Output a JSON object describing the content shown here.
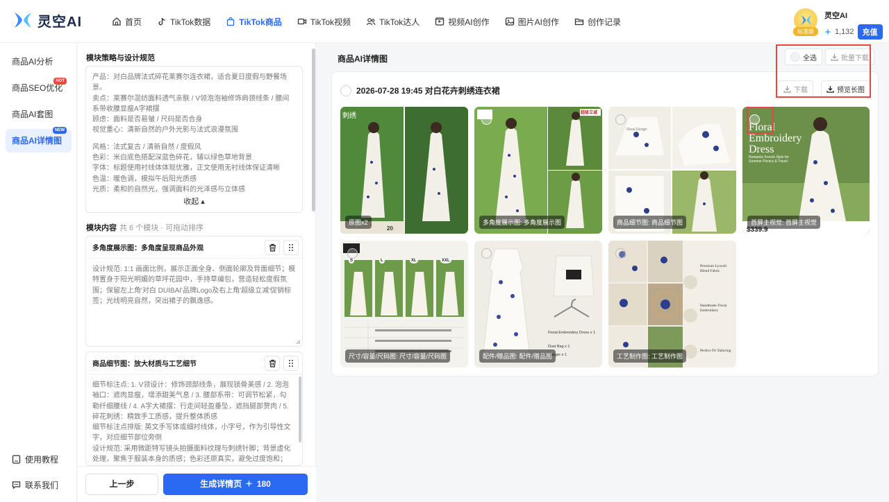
{
  "app": {
    "name": "灵空AI"
  },
  "nav": [
    {
      "label": "首页",
      "icon": "home-icon"
    },
    {
      "label": "TikTok数据",
      "icon": "tiktok-icon"
    },
    {
      "label": "TikTok商品",
      "icon": "shopping-bag-icon"
    },
    {
      "label": "TikTok视频",
      "icon": "video-icon"
    },
    {
      "label": "TikTok达人",
      "icon": "users-icon"
    },
    {
      "label": "视频AI创作",
      "icon": "video-ai-icon"
    },
    {
      "label": "图片AI创作",
      "icon": "image-icon"
    },
    {
      "label": "创作记录",
      "icon": "folder-icon"
    }
  ],
  "user": {
    "name": "灵空AI",
    "badge": "标准版",
    "credits": "1,132",
    "topup": "充值"
  },
  "sidebar": {
    "items": [
      {
        "label": "商品AI分析"
      },
      {
        "label": "商品SEO优化",
        "tag": "HOT"
      },
      {
        "label": "商品AI套图"
      },
      {
        "label": "商品AI详情图",
        "tag": "NEW"
      }
    ],
    "tutorial": "使用教程",
    "contact": "联系我们"
  },
  "strategy": {
    "title": "模块策略与设计规范",
    "lines1": [
      "产品：对白品牌法式碎花莱赛尔连衣裙，适合夏日度假与野餐场景。",
      "卖点：莱赛尔混纺面料透气亲肤 / V领泡泡袖修饰肩颈线条 / 腰间系带收腰显瘦A字裙摆",
      "顾虑：面料是否易皱 / 尺码是否合身",
      "视觉重心：清新自然的户外光影与法式浪漫氛围"
    ],
    "lines2": [
      "风格：法式复古 / 清新自然 / 度假风",
      "色彩：米白底色搭配深蓝色碎花，辅以绿色草地背景",
      "字体：标题使用衬线体体现优雅，正文使用无衬线体保证清晰",
      "色温：暖色调，模拟午后阳光质感",
      "光质：柔和的自然光，强调面料的光泽感与立体感"
    ],
    "collapse": "收起"
  },
  "modules": {
    "title": "模块内容",
    "subtitle": "共 6 个模块 · 可拖动排序",
    "items": [
      {
        "title": "多角度展示图：多角度呈现商品外观",
        "body": "设计规范: 1:1 画面比例，展示正面全身、侧面轮廓及背面细节；模特置身于阳光明媚的草坪花园中，手持草编包，营造轻松度假氛围；保留左上角'对白 DUIBAI'品牌Logo及右上角'超级立减'促销标签；光线明亮自然，突出裙子的飘逸感。"
      },
      {
        "title": "商品细节图：放大材质与工艺细节",
        "body": "细节标注点: 1. V领设计：修饰颈部线条，展现锁骨美感 / 2. 泡泡袖口：遮肉显瘦，增添甜美气息 / 3. 腰部系带：可调节松紧，勾勒纤细腰线 / 4. A字大裙摆：行走间轻盈垂坠，遮挡腿部赘肉 / 5. 碎花刺绣：精致手工质感，提升整体质感\n细节标注点排版: 英文手写体或细衬线体，小字号，作为引导性文字，对应细节部位旁侧\n设计规范: 采用微距特写镜头拍摄面料纹理与刺绣针脚；背景虚化处理，聚焦于服装本身的质感；色彩还原真实，避免过度饱和；保留参考"
      }
    ]
  },
  "actions": {
    "prev": "上一步",
    "generate": "生成详情页",
    "cost": "180"
  },
  "main": {
    "title": "商品AI详情图",
    "select_all": "全选",
    "batch_download": "批量下载",
    "card": {
      "title": "2026-07-28 19:45 对白花卉刺绣连衣裙",
      "download": "下载",
      "preview": "预览长图",
      "images": [
        {
          "label": "原图x2",
          "overlay": "刺绣",
          "price": "20"
        },
        {
          "label": "多角度展示图: 多角度展示图",
          "overlay": "超级立减"
        },
        {
          "label": "商品细节图: 商品细节图",
          "overlay": "Floral Design"
        },
        {
          "label": "首屏主视觉: 首屏主视觉",
          "overlay": "Floral Embroidery Dress",
          "sub": "Romantic French Style for Summer Picnics & Travel",
          "price": "$339.9"
        },
        {
          "label": "尺寸/容量/尺码图: 尺寸/容量/尺码图",
          "sizes": [
            "S",
            "L",
            "XL",
            "XXL"
          ]
        },
        {
          "label": "配件/赠品图: 配件/赠品图",
          "items": [
            "Floral Embroidery Dress x 1",
            "Dust Bag x 1",
            "Hanger x 1"
          ]
        },
        {
          "label": "工艺制作图: 工艺制作图",
          "notes": [
            "Premium Lyocell Blend Fabric",
            "Handmade Floral Embroidery",
            "Perfect Fit Tailoring"
          ]
        }
      ]
    }
  },
  "colors": {
    "accent": "#2a6af3",
    "hot": "#f0463c",
    "highlight": "#e64545"
  }
}
